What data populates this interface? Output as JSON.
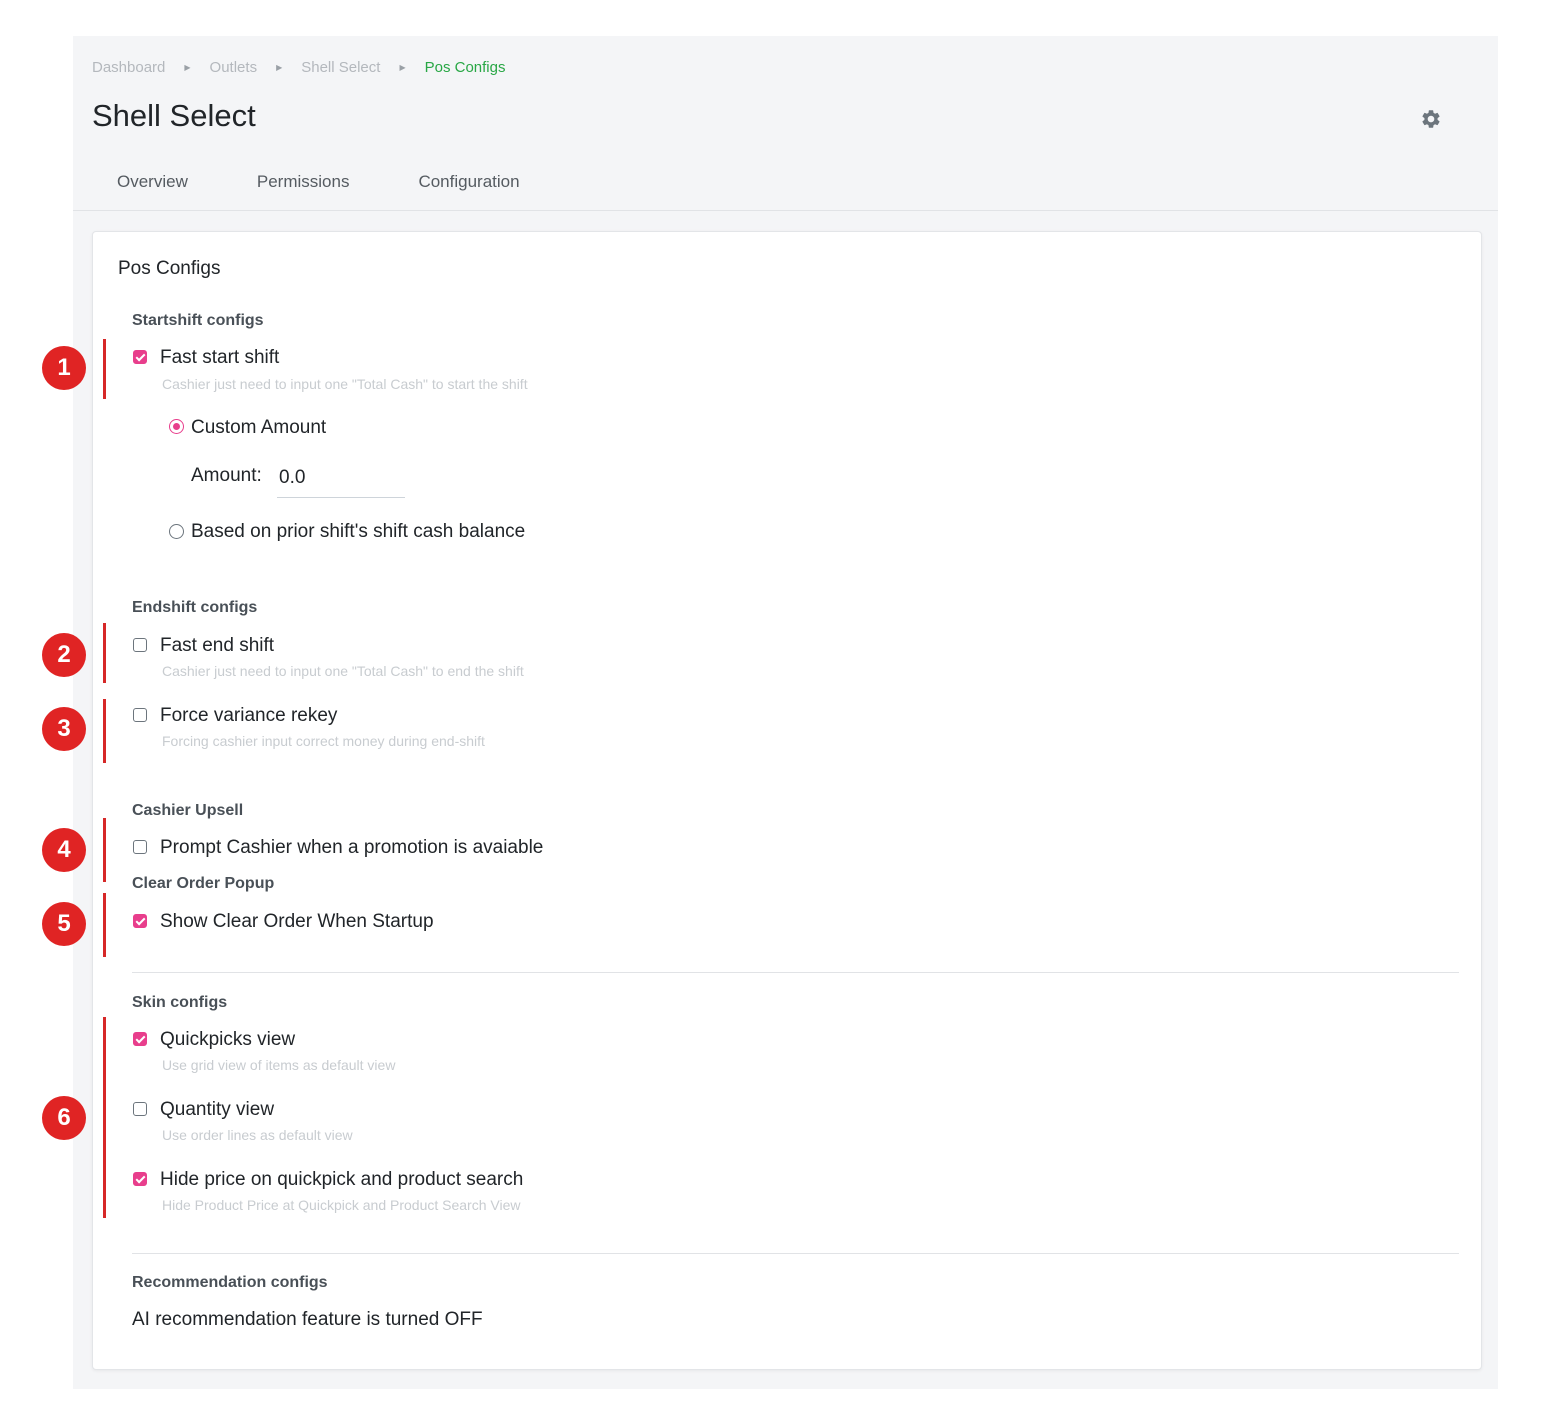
{
  "breadcrumb": {
    "items": [
      "Dashboard",
      "Outlets",
      "Shell Select"
    ],
    "active": "Pos Configs"
  },
  "page_title": "Shell Select",
  "tabs": [
    "Overview",
    "Permissions",
    "Configuration"
  ],
  "card_title": "Pos Configs",
  "startshift": {
    "heading": "Startshift configs",
    "fast_start": {
      "label": "Fast start shift",
      "description": "Cashier just need to input one \"Total Cash\" to start the shift",
      "checked": true
    },
    "custom_amount": {
      "label": "Custom Amount",
      "selected": true
    },
    "amount_label": "Amount:",
    "amount_value": "0.0",
    "prior_balance": {
      "label": "Based on prior shift's shift cash balance",
      "selected": false
    }
  },
  "endshift": {
    "heading": "Endshift configs",
    "fast_end": {
      "label": "Fast end shift",
      "description": "Cashier just need to input one \"Total Cash\" to end the shift",
      "checked": false
    },
    "force_variance": {
      "label": "Force variance rekey",
      "description": "Forcing cashier input correct money during end-shift",
      "checked": false
    }
  },
  "upsell": {
    "heading": "Cashier Upsell",
    "prompt": {
      "label": "Prompt Cashier when a promotion is avaiable",
      "checked": false
    }
  },
  "clear_order": {
    "heading": "Clear Order Popup",
    "show": {
      "label": "Show Clear Order When Startup",
      "checked": true
    }
  },
  "skin": {
    "heading": "Skin configs",
    "quickpicks": {
      "label": "Quickpicks view",
      "description": "Use grid view of items as default view",
      "checked": true
    },
    "quantity": {
      "label": "Quantity view",
      "description": "Use order lines as default view",
      "checked": false
    },
    "hide_price": {
      "label": "Hide price on quickpick and product search",
      "description": "Hide Product Price at Quickpick and Product Search View",
      "checked": true
    }
  },
  "recommendation": {
    "heading": "Recommendation configs",
    "status": "AI recommendation feature is turned OFF"
  },
  "markers": [
    "1",
    "2",
    "3",
    "4",
    "5",
    "6"
  ],
  "colors": {
    "accent": "#e83e8c",
    "breadcrumb_active": "#28a745",
    "marker": "#e02424"
  },
  "icons": {
    "settings": "gear-icon"
  }
}
